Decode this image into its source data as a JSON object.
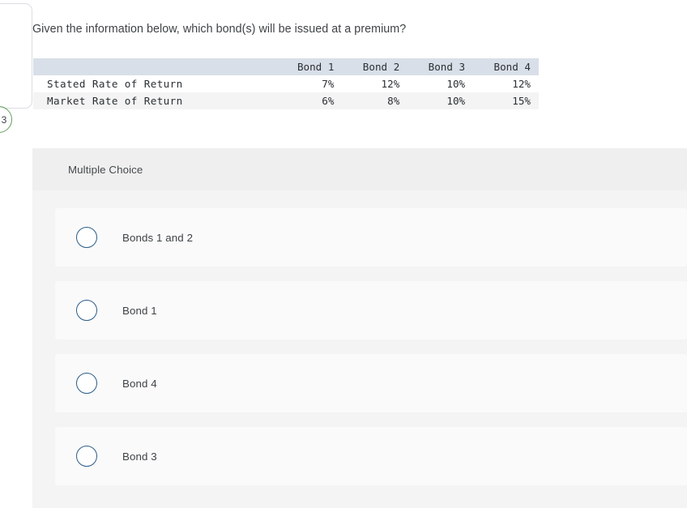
{
  "question_badge": {
    "number": "3"
  },
  "prompt": {
    "text": "Given the information below, which bond(s) will be issued at a premium?"
  },
  "exhibit_table": {
    "corner_header": "",
    "column_headers": [
      "Bond 1",
      "Bond 2",
      "Bond 3",
      "Bond 4"
    ],
    "rows": [
      {
        "label": "Stated Rate of Return",
        "values": [
          "7%",
          "12%",
          "10%",
          "12%"
        ]
      },
      {
        "label": "Market Rate of Return",
        "values": [
          "6%",
          "8%",
          "10%",
          "15%"
        ]
      }
    ]
  },
  "answer_panel": {
    "header_label": "Multiple Choice",
    "options": [
      {
        "label": "Bonds 1 and 2",
        "selected": false
      },
      {
        "label": "Bond 1",
        "selected": false
      },
      {
        "label": "Bond 4",
        "selected": false
      },
      {
        "label": "Bond 3",
        "selected": false
      }
    ]
  },
  "colors": {
    "page_background": "#ffffff",
    "table_header_fill": "#d8dfe8",
    "table_row_alt_fill": "#f4f4f4",
    "panel_background": "#f4f4f4",
    "panel_header_fill": "#efefef",
    "option_card_fill": "#fafafa",
    "radio_border": "#2b5d88",
    "badge_border": "#64a05c",
    "text_primary": "#3f4346"
  }
}
